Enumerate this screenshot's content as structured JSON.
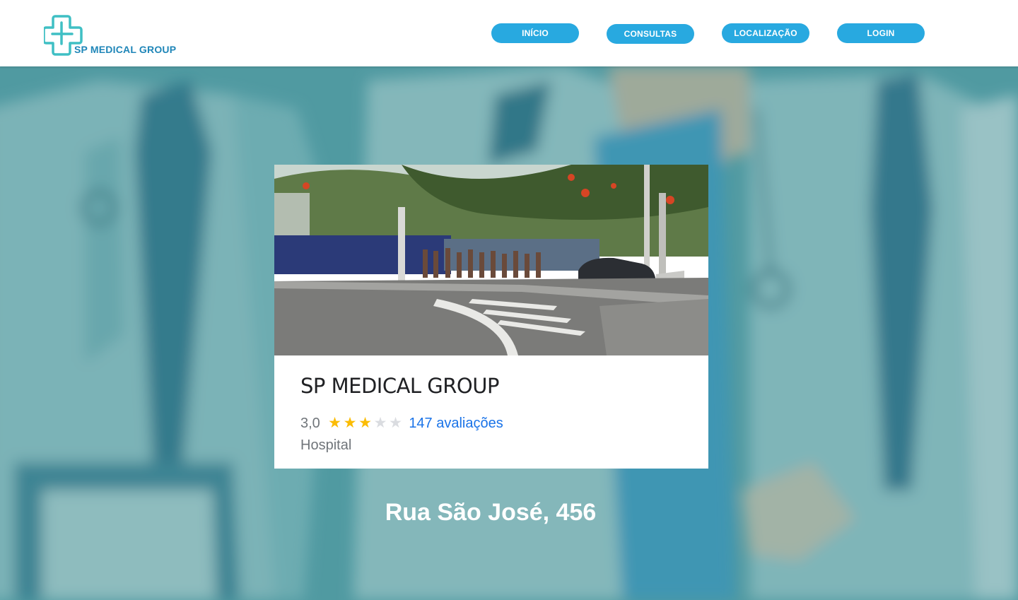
{
  "brand": {
    "name": "SP MEDICAL GROUP",
    "logo_icon": "medical-cross-icon",
    "color": "#1f86b8",
    "accent": "#3fbfc4"
  },
  "nav": {
    "color": "#28a9e0",
    "items": [
      {
        "label": "INÍCIO"
      },
      {
        "label": "CONSULTAS"
      },
      {
        "label": "LOCALIZAÇÃO"
      },
      {
        "label": "LOGIN"
      }
    ]
  },
  "hero": {
    "background_image": "doctors-group-photo",
    "overlay_color": "#4f9aa2"
  },
  "place_card": {
    "photo": "hospital-street-photo",
    "name": "SP MEDICAL GROUP",
    "rating": "3,0",
    "rating_value": 3,
    "rating_max": 5,
    "reviews": "147 avaliações",
    "category": "Hospital"
  },
  "address": "Rua São José, 456"
}
